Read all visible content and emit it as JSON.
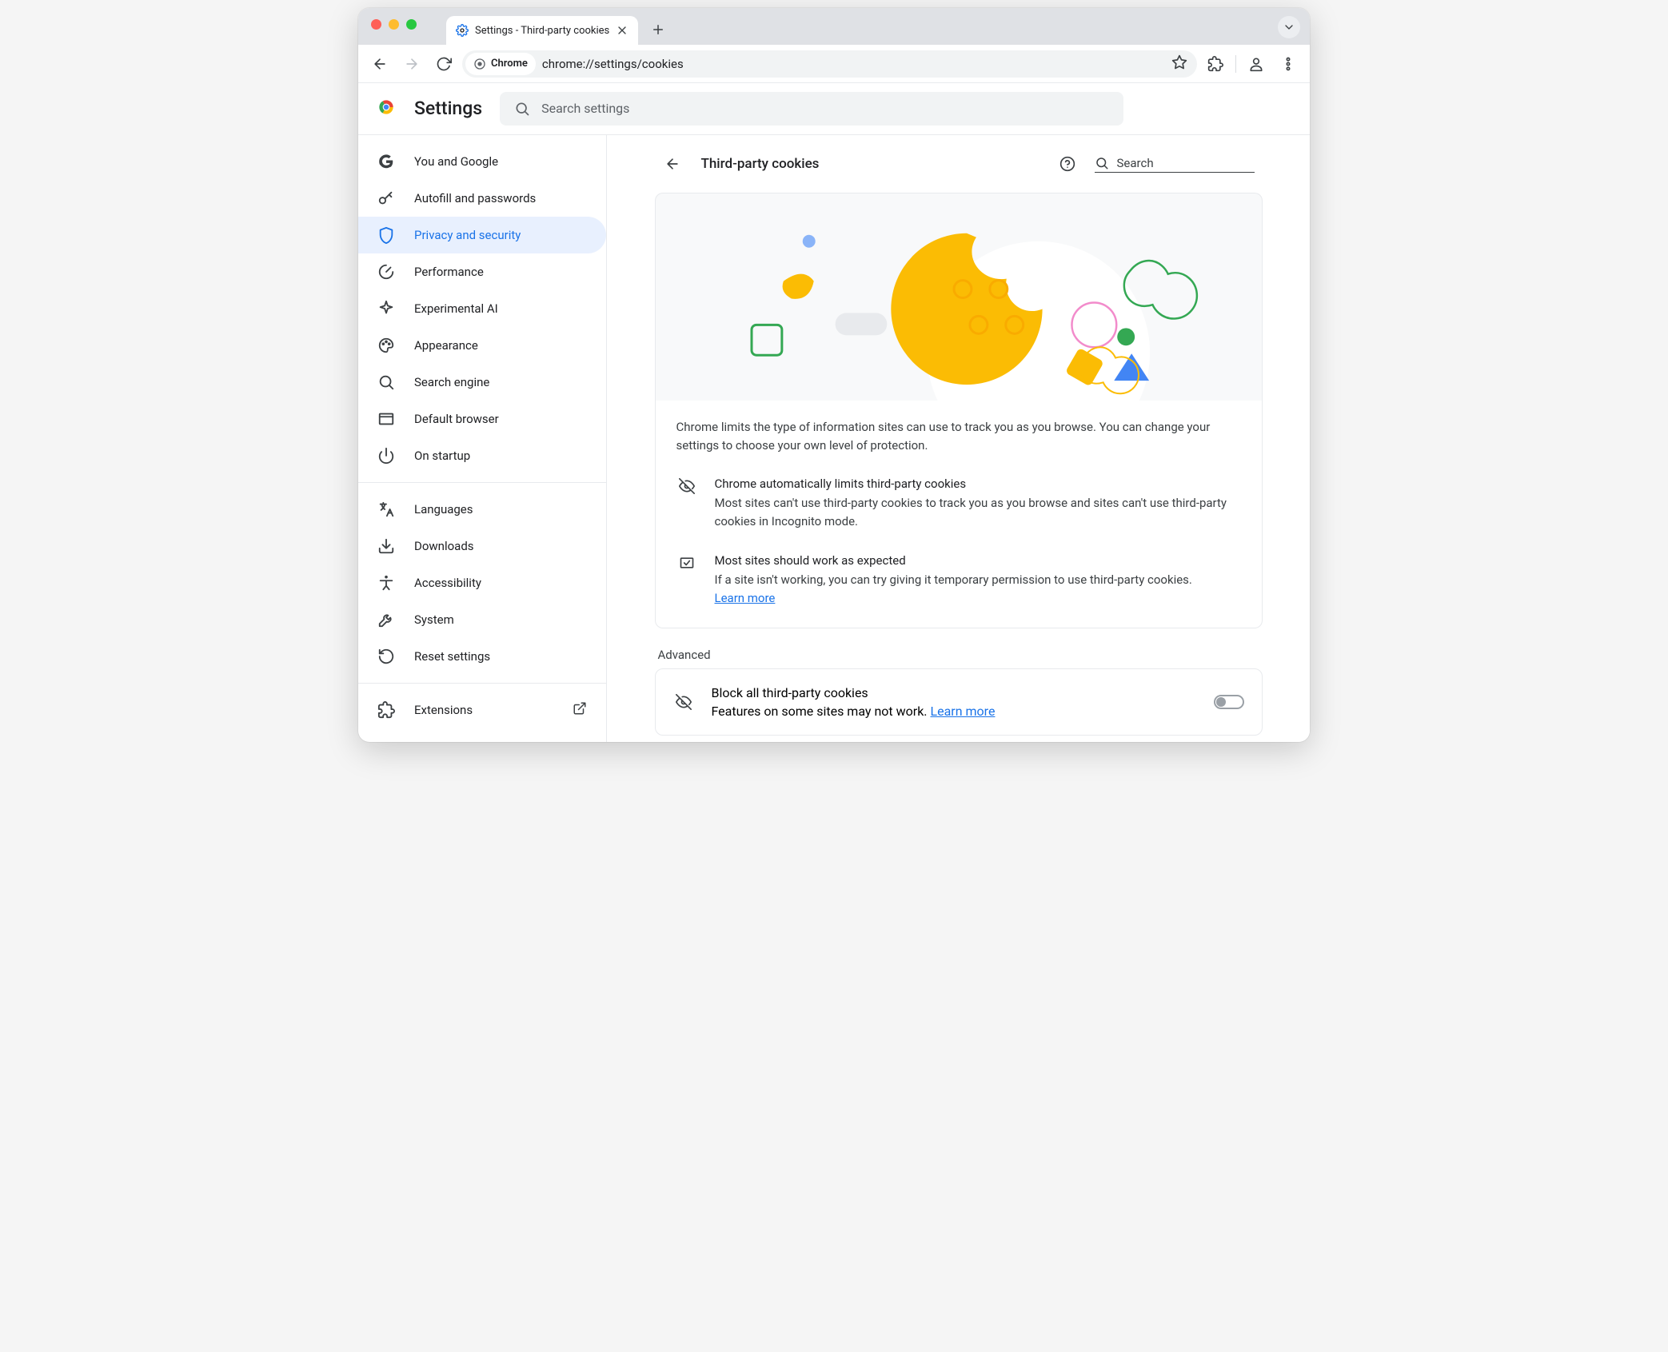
{
  "browser": {
    "tab_title": "Settings - Third-party cookies",
    "omnibox_chip": "Chrome",
    "url": "chrome://settings/cookies"
  },
  "header": {
    "app_title": "Settings",
    "search_placeholder": "Search settings"
  },
  "sidebar": {
    "items": [
      {
        "label": "You and Google"
      },
      {
        "label": "Autofill and passwords"
      },
      {
        "label": "Privacy and security"
      },
      {
        "label": "Performance"
      },
      {
        "label": "Experimental AI"
      },
      {
        "label": "Appearance"
      },
      {
        "label": "Search engine"
      },
      {
        "label": "Default browser"
      },
      {
        "label": "On startup"
      }
    ],
    "items2": [
      {
        "label": "Languages"
      },
      {
        "label": "Downloads"
      },
      {
        "label": "Accessibility"
      },
      {
        "label": "System"
      },
      {
        "label": "Reset settings"
      }
    ],
    "items3": [
      {
        "label": "Extensions"
      }
    ]
  },
  "page": {
    "title": "Third-party cookies",
    "inline_search_placeholder": "Search",
    "intro": "Chrome limits the type of information sites can use to track you as you browse. You can change your settings to choose your own level of protection.",
    "info1_title": "Chrome automatically limits third-party cookies",
    "info1_body": "Most sites can't use third-party cookies to track you as you browse and sites can't use third-party cookies in Incognito mode.",
    "info2_title": "Most sites should work as expected",
    "info2_body_prefix": "If a site isn't working, you can try giving it temporary permission to use third-party cookies. ",
    "learn_more": "Learn more",
    "advanced_label": "Advanced",
    "block_title": "Block all third-party cookies",
    "block_body_prefix": "Features on some sites may not work. "
  }
}
